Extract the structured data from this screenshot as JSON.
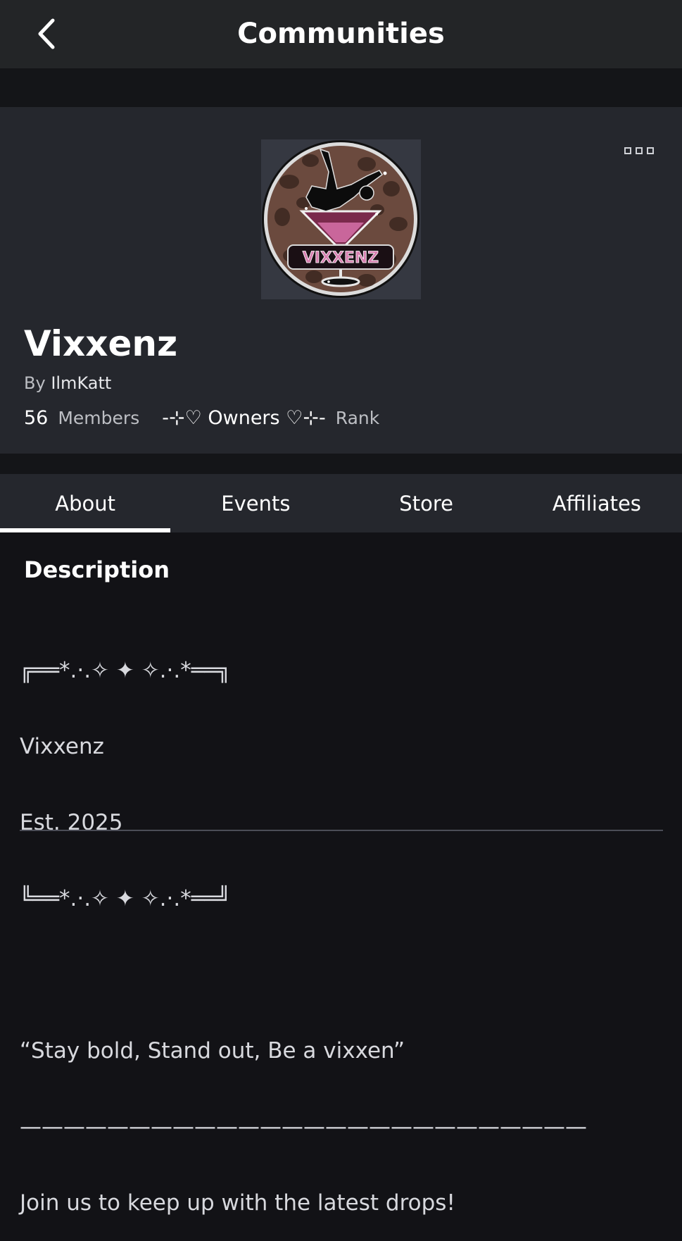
{
  "header": {
    "title": "Communities"
  },
  "group": {
    "name": "Vixxenz",
    "logo_text": "VIXXENZ",
    "by_label": "By",
    "owner": "IlmKatt",
    "member_count": "56",
    "member_label": "Members",
    "rank_name": "-⊹♡ Owners ♡⊹-",
    "rank_label": "Rank"
  },
  "tabs": [
    {
      "label": "About",
      "active": true
    },
    {
      "label": "Events",
      "active": false
    },
    {
      "label": "Store",
      "active": false
    },
    {
      "label": "Affiliates",
      "active": false
    }
  ],
  "about": {
    "section_title": "Description",
    "lines": [
      "╔══*.·.✧ ✦ ✧.·.*══╗",
      "Vixxenz",
      "Est. 2025",
      "╚══*.·.✧ ✦ ✧.·.*══╝",
      "",
      "“Stay bold, Stand out, Be a vixxen”",
      "——————————————————————————",
      "Join us to keep up with the latest drops!"
    ]
  },
  "icons": {
    "back": "chevron-left-icon",
    "more": "more-options-icon"
  },
  "colors": {
    "topbar": "#232527",
    "card": "#25272d",
    "page_bg": "#121216",
    "logo_pink": "#c9669b"
  }
}
